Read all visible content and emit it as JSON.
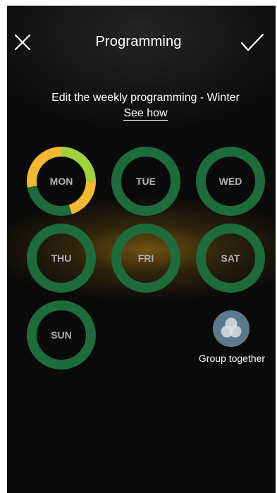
{
  "header": {
    "title": "Programming",
    "close_icon": "close-icon",
    "confirm_icon": "checkmark-icon"
  },
  "intro": {
    "subtitle": "Edit the weekly programming - Winter",
    "see_how": "See how"
  },
  "days": [
    {
      "label": "MON",
      "segments": [
        {
          "color": "#9fd13d",
          "from": 0,
          "to": 0.25
        },
        {
          "color": "#f2b930",
          "from": 0.25,
          "to": 0.45
        },
        {
          "color": "#1e6b3c",
          "from": 0.45,
          "to": 0.72
        },
        {
          "color": "#f2b930",
          "from": 0.72,
          "to": 1.0
        }
      ]
    },
    {
      "label": "TUE",
      "segments": [
        {
          "color": "#1e6b3c",
          "from": 0,
          "to": 1
        }
      ]
    },
    {
      "label": "WED",
      "segments": [
        {
          "color": "#1e6b3c",
          "from": 0,
          "to": 1
        }
      ]
    },
    {
      "label": "THU",
      "segments": [
        {
          "color": "#1e6b3c",
          "from": 0,
          "to": 1
        }
      ]
    },
    {
      "label": "FRI",
      "segments": [
        {
          "color": "#1e6b3c",
          "from": 0,
          "to": 1
        }
      ]
    },
    {
      "label": "SAT",
      "segments": [
        {
          "color": "#1e6b3c",
          "from": 0,
          "to": 1
        }
      ]
    },
    {
      "label": "SUN",
      "segments": [
        {
          "color": "#1e6b3c",
          "from": 0,
          "to": 1
        }
      ]
    }
  ],
  "group": {
    "label": "Group together",
    "icon": "group-circles-icon"
  },
  "colors": {
    "green": "#1e6b3c",
    "yellow": "#f2b930",
    "light_green": "#9fd13d",
    "group_icon": "#5a7a8e"
  }
}
